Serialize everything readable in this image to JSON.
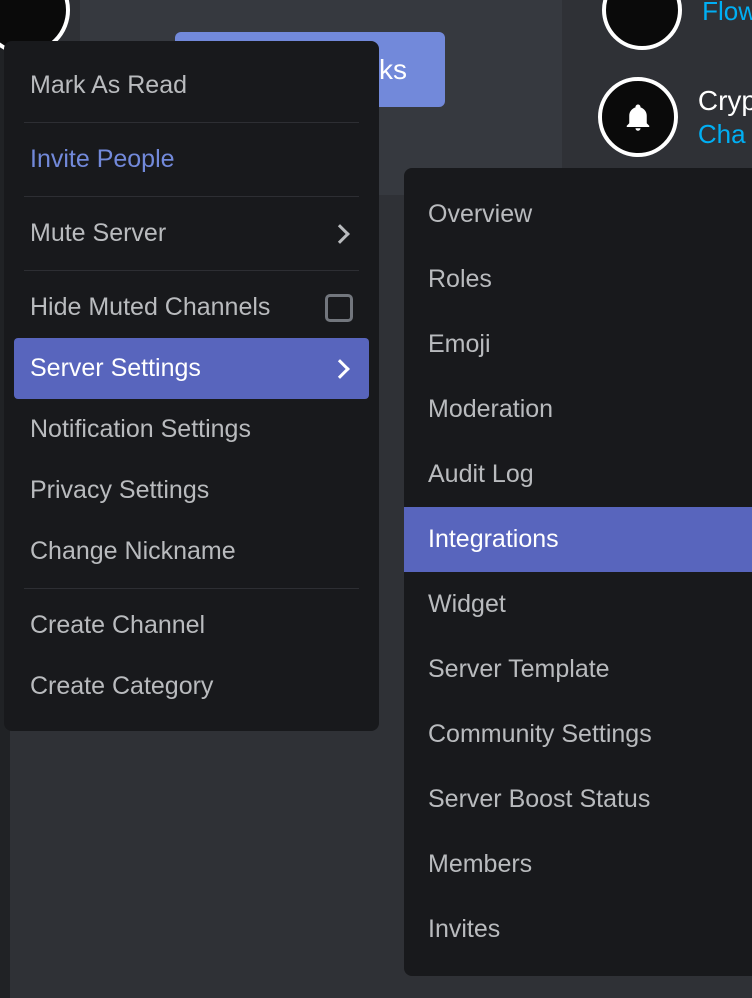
{
  "background": {
    "perks_button_partial": "erks"
  },
  "servers": {
    "row1": {
      "title_partial": "",
      "sub_partial": "Flow"
    },
    "row2": {
      "title_partial": "Cryp",
      "sub_partial": "Cha"
    }
  },
  "contextMenu": {
    "markAsRead": "Mark As Read",
    "invitePeople": "Invite People",
    "muteServer": "Mute Server",
    "hideMuted": "Hide Muted Channels",
    "serverSettings": "Server Settings",
    "notificationSettings": "Notification Settings",
    "privacySettings": "Privacy Settings",
    "changeNickname": "Change Nickname",
    "createChannel": "Create Channel",
    "createCategory": "Create Category"
  },
  "submenu": {
    "overview": "Overview",
    "roles": "Roles",
    "emoji": "Emoji",
    "moderation": "Moderation",
    "auditLog": "Audit Log",
    "integrations": "Integrations",
    "widget": "Widget",
    "serverTemplate": "Server Template",
    "communitySettings": "Community Settings",
    "serverBoostStatus": "Server Boost Status",
    "members": "Members",
    "invites": "Invites"
  }
}
